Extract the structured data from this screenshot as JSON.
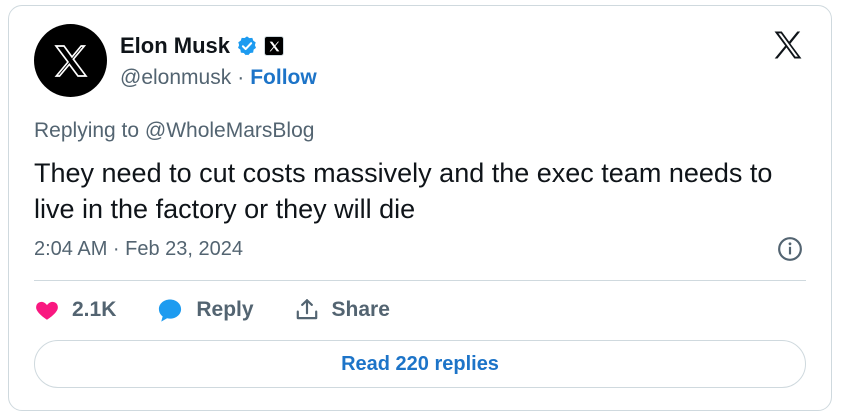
{
  "author": {
    "display_name": "Elon Musk",
    "handle": "@elonmusk",
    "separator": "·",
    "follow_label": "Follow",
    "avatar_icon": "x-logo-icon",
    "verified_icon": "verified-badge-icon",
    "affiliation_icon": "x-affiliate-badge-icon"
  },
  "tweet": {
    "replying_to": "Replying to @WholeMarsBlog",
    "text": "They need to cut costs massively and the exec team needs to live in the factory or they will die",
    "timestamp": "2:04 AM · Feb 23, 2024"
  },
  "actions": {
    "likes": "2.1K",
    "reply_label": "Reply",
    "share_label": "Share"
  },
  "read_replies_label": "Read 220 replies",
  "colors": {
    "link_blue": "#1d74c8",
    "verified_blue": "#1d9bf0",
    "like_pink": "#f91880",
    "muted_text": "#536471",
    "border": "#cfd9de"
  }
}
